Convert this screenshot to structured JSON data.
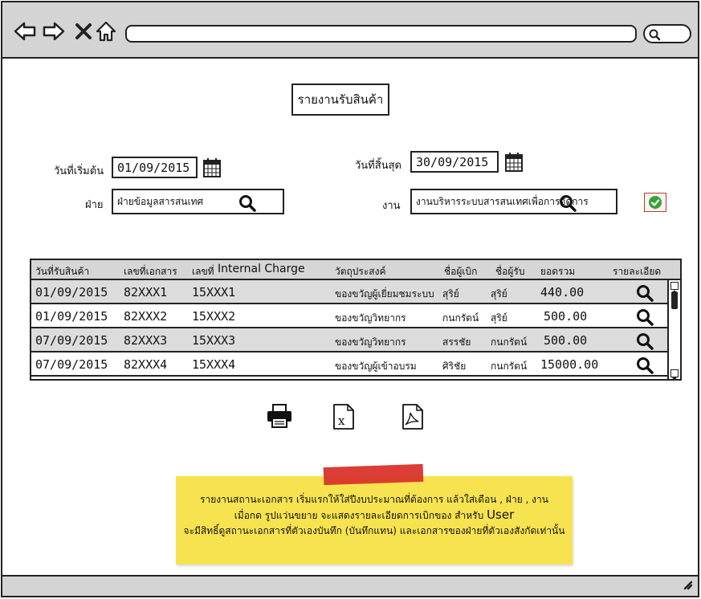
{
  "page": {
    "title": "รายงานรับสินค้า"
  },
  "filters": {
    "start_date_label": "วันที่เริ่มต้น",
    "start_date_value": "01/09/2015",
    "end_date_label": "วันที่สิ้นสุด",
    "end_date_value": "30/09/2015",
    "department_label": "ฝ่าย",
    "department_value": "ฝ่ายข้อมูลสารสนเทศ",
    "work_label": "งาน",
    "work_value": "งานบริหารระบบสารสนเทศเพื่อการจัดการ"
  },
  "table": {
    "headers": [
      "วันที่รับสินค้า",
      "เลขที่เอกสาร",
      "เลขที่",
      "Internal Charge",
      "วัตถุประสงค์",
      "ชื่อผู้เบิก",
      "ชื่อผู้รับ",
      "ยอดรวม",
      "รายละเอียด"
    ],
    "rows": [
      {
        "date": "01/09/2015",
        "doc": "82XXX1",
        "ic": "15XXX1",
        "purpose": "ของขวัญผู้เยี่ยมชมระบบ",
        "requester": "สุริย์",
        "receiver": "สุริย์",
        "total": "440.00"
      },
      {
        "date": "01/09/2015",
        "doc": "82XXX2",
        "ic": "15XXX2",
        "purpose": "ของขวัญวิทยากร",
        "requester": "กนกรัตน์",
        "receiver": "สุริย์",
        "total": "500.00"
      },
      {
        "date": "07/09/2015",
        "doc": "82XXX3",
        "ic": "15XXX3",
        "purpose": "ของขวัญวิทยากร",
        "requester": "สรรชัย",
        "receiver": "กนกรัตน์",
        "total": "500.00"
      },
      {
        "date": "07/09/2015",
        "doc": "82XXX4",
        "ic": "15XXX4",
        "purpose": "ของขวัญผู้เข้าอบรม",
        "requester": "ศิริชัย",
        "receiver": "กนกรัตน์",
        "total": "15000.00"
      }
    ]
  },
  "note": {
    "line1": "รายงานสถานะเอกสาร เริ่มแรกให้ใส่ปีงบประมาณที่ต้องการ แล้วใส่เดือน ,  ฝ่าย , งาน",
    "line2_a": "เมื่อกด รูปแว่นขยาย จะแสดงรายละเอียดการเบิกของ สำหรับ",
    "line2_b": "User",
    "line3": "จะมีสิทธิ์ดูสถานะเอกสารที่ตัวเองบันทึก (บันทึกแทน) และเอกสารของฝ่ายที่ตัวเองสังกัดเท่านั้น"
  },
  "icons": {
    "back": "arrow-left-icon",
    "forward": "arrow-right-icon",
    "close": "close-icon",
    "home": "home-icon",
    "search": "search-icon",
    "calendar": "calendar-icon",
    "confirm": "check-circle-icon",
    "print": "printer-icon",
    "excel": "excel-file-icon",
    "pdf": "pdf-file-icon"
  },
  "colors": {
    "chrome": "#d4d4d4",
    "header_row": "#d6d6d6",
    "alt_row": "#dcdcdc",
    "note_bg": "#f7e34f",
    "tape": "#d9342b",
    "confirm_green": "#3aa135"
  }
}
